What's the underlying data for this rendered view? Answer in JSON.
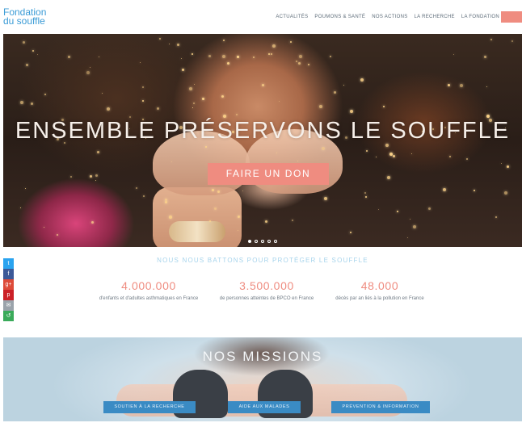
{
  "header": {
    "logo_line1": "Fondation",
    "logo_line2": "du souffle",
    "nav": [
      "ACTUALITÉS",
      "POUMONS & SANTÉ",
      "NOS ACTIONS",
      "LA RECHERCHE",
      "LA FONDATION"
    ]
  },
  "hero": {
    "title": "ENSEMBLE PRÉSERVONS LE SOUFFLE",
    "donate_label": "FAIRE UN DON",
    "slides_total": 5,
    "slide_active": 1
  },
  "share": {
    "icons": [
      {
        "name": "twitter-icon",
        "glyph": "t",
        "color": "#2aa3ef"
      },
      {
        "name": "facebook-icon",
        "glyph": "f",
        "color": "#3b5998"
      },
      {
        "name": "google-plus-icon",
        "glyph": "g+",
        "color": "#dd4b39"
      },
      {
        "name": "pinterest-icon",
        "glyph": "p",
        "color": "#cb2027"
      },
      {
        "name": "email-icon",
        "glyph": "✉",
        "color": "#9aa3ab"
      },
      {
        "name": "share-icon",
        "glyph": "↺",
        "color": "#3aaa5a"
      }
    ]
  },
  "stats": {
    "title": "NOUS NOUS BATTONS POUR PROTÉGER LE SOUFFLE",
    "items": [
      {
        "value": "4.000.000",
        "text": "d'enfants et d'adultes asthmatiques en France"
      },
      {
        "value": "3.500.000",
        "text": "de personnes atteintes de BPCO en France"
      },
      {
        "value": "48.000",
        "text": "décès par an liés à la pollution en France"
      }
    ]
  },
  "missions": {
    "title": "NOS MISSIONS",
    "buttons": [
      "SOUTIEN À LA RECHERCHE",
      "AIDE AUX MALADES",
      "PRÉVENTION & INFORMATION"
    ]
  }
}
